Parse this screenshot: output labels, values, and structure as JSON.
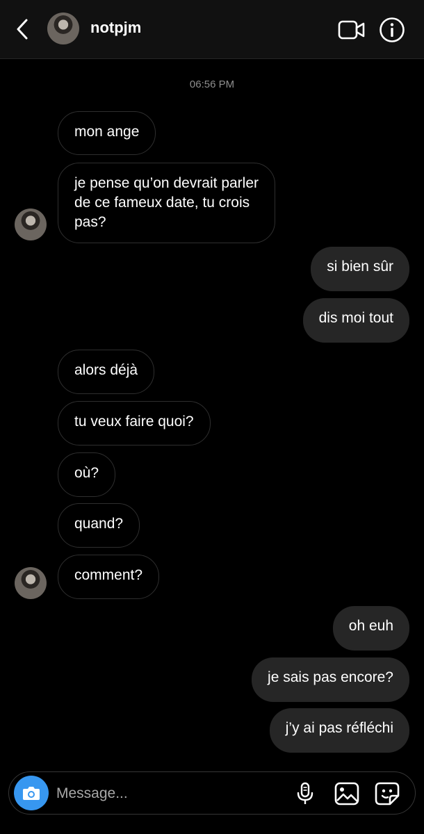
{
  "header": {
    "username": "notpjm",
    "icons": [
      "back-icon",
      "video-call-icon",
      "info-icon"
    ]
  },
  "thread": {
    "timestamp": "06:56 PM",
    "messages": [
      {
        "from": "them",
        "text": "mon ange"
      },
      {
        "from": "them",
        "text": "je pense qu’on devrait parler\nde ce fameux date, tu crois\npas?"
      },
      {
        "from": "me",
        "text": "si bien sûr"
      },
      {
        "from": "me",
        "text": "dis moi tout"
      },
      {
        "from": "them",
        "text": "alors déjà"
      },
      {
        "from": "them",
        "text": "tu veux faire quoi?"
      },
      {
        "from": "them",
        "text": "où?"
      },
      {
        "from": "them",
        "text": "quand?"
      },
      {
        "from": "them",
        "text": "comment?"
      },
      {
        "from": "me",
        "text": "oh euh"
      },
      {
        "from": "me",
        "text": "je sais pas encore?"
      },
      {
        "from": "me",
        "text": "j’y ai pas réfléchi"
      }
    ]
  },
  "composer": {
    "placeholder": "Message...",
    "accent": "#3797f0",
    "icons": [
      "camera-icon",
      "microphone-icon",
      "gallery-icon",
      "sticker-icon"
    ]
  }
}
